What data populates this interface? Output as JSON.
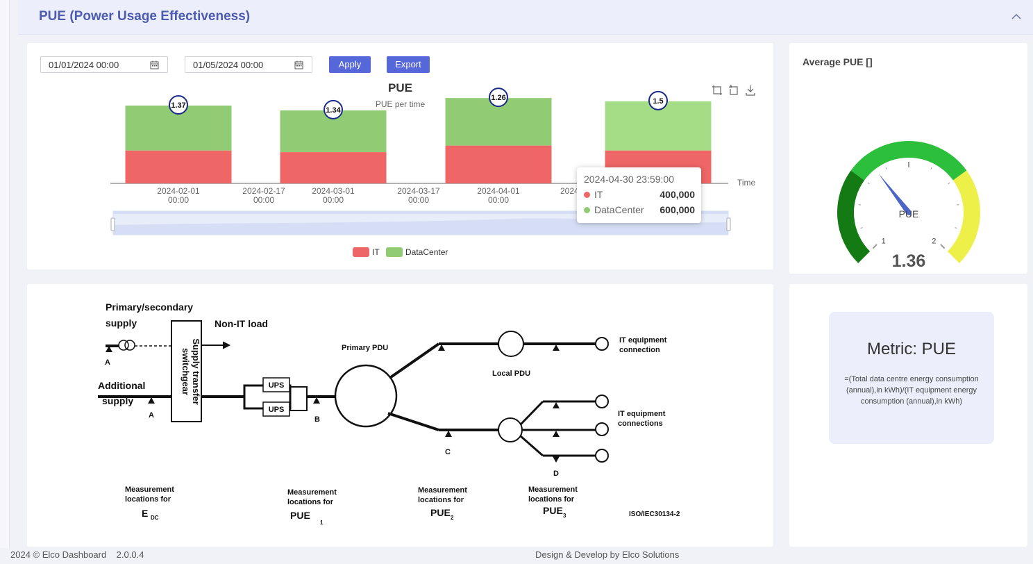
{
  "section": {
    "title": "PUE (Power Usage Effectiveness)"
  },
  "toolbar": {
    "start_date": "01/01/2024 00:00",
    "end_date": "01/05/2024 00:00",
    "apply_label": "Apply",
    "export_label": "Export"
  },
  "chart_data": {
    "type": "bar",
    "title": "PUE",
    "subtitle": "PUE per time",
    "x_axis_name": "Time",
    "stacked": true,
    "categories": [
      "2024-02-01 00:00",
      "2024-03-01 00:00",
      "2024-04-01 00:00",
      "2024-04-30 23:59:00"
    ],
    "x_tick_labels": [
      {
        "date": "2024-02-01",
        "time": "00:00"
      },
      {
        "date": "2024-02-17",
        "time": "00:00"
      },
      {
        "date": "2024-03-01",
        "time": "00:00"
      },
      {
        "date": "2024-03-17",
        "time": "00:00"
      },
      {
        "date": "2024-04-01",
        "time": "00:00"
      },
      {
        "date": "2024-04",
        "time": ""
      }
    ],
    "series": [
      {
        "name": "IT",
        "color": "#ee6666",
        "values": [
          400000,
          380000,
          460000,
          400000
        ]
      },
      {
        "name": "DataCenter",
        "color": "#91cc75",
        "values": [
          548000,
          509200,
          579600,
          600000
        ]
      }
    ],
    "pue_labels": [
      "1.37",
      "1.34",
      "1.26",
      "1.5"
    ],
    "ylim": [
      0,
      1100000
    ],
    "grid": false,
    "legend_position": "bottom-center",
    "tooltip": {
      "title": "2024-04-30 23:59:00",
      "rows": [
        {
          "name": "IT",
          "value": "400,000",
          "color": "#ee6666"
        },
        {
          "name": "DataCenter",
          "value": "600,000",
          "color": "#91cc75"
        }
      ]
    }
  },
  "gauge": {
    "title": "Average PUE []",
    "label": "PUE",
    "value": "1.36",
    "numeric_value": 1.36,
    "min": 1,
    "max": 2,
    "min_label": "1",
    "max_label": "2",
    "colors": {
      "low": "#147a14",
      "mid": "#2cbf3c",
      "high": "#eef04a",
      "needle": "#4a64c8"
    }
  },
  "diagram": {
    "primary_secondary_supply_1": "Primary/secondary",
    "primary_secondary_supply_2": "supply",
    "non_it_load": "Non-IT load",
    "additional_supply_1": "Additional",
    "additional_supply_2": "supply",
    "switchgear_1": "Supply transfer",
    "switchgear_2": "switchgear",
    "ups": "UPS",
    "primary_pdu": "Primary PDU",
    "local_pdu": "Local PDU",
    "it_connection_1": "IT equipment",
    "it_connection_2": "connection",
    "it_connections_2": "connections",
    "point_a": "A",
    "point_b": "B",
    "point_c": "C",
    "point_d": "D",
    "measurement_1": "Measurement",
    "measurement_2": "locations for",
    "e_label": "E",
    "e_sub": "DC",
    "pue_label": "PUE",
    "pue_sub_1": "1",
    "pue_sub_2": "2",
    "pue_sub_3": "3",
    "standard": "ISO/IEC30134-2"
  },
  "metric": {
    "title": "Metric: PUE",
    "formula": "=(Total data centre energy consumption (annual),in kWh)/(IT equipment energy consumption (annual),in kWh)"
  },
  "footer": {
    "left": "2024 © Elco Dashboard    2.0.0.4",
    "center": "Design & Develop by Elco Solutions"
  }
}
